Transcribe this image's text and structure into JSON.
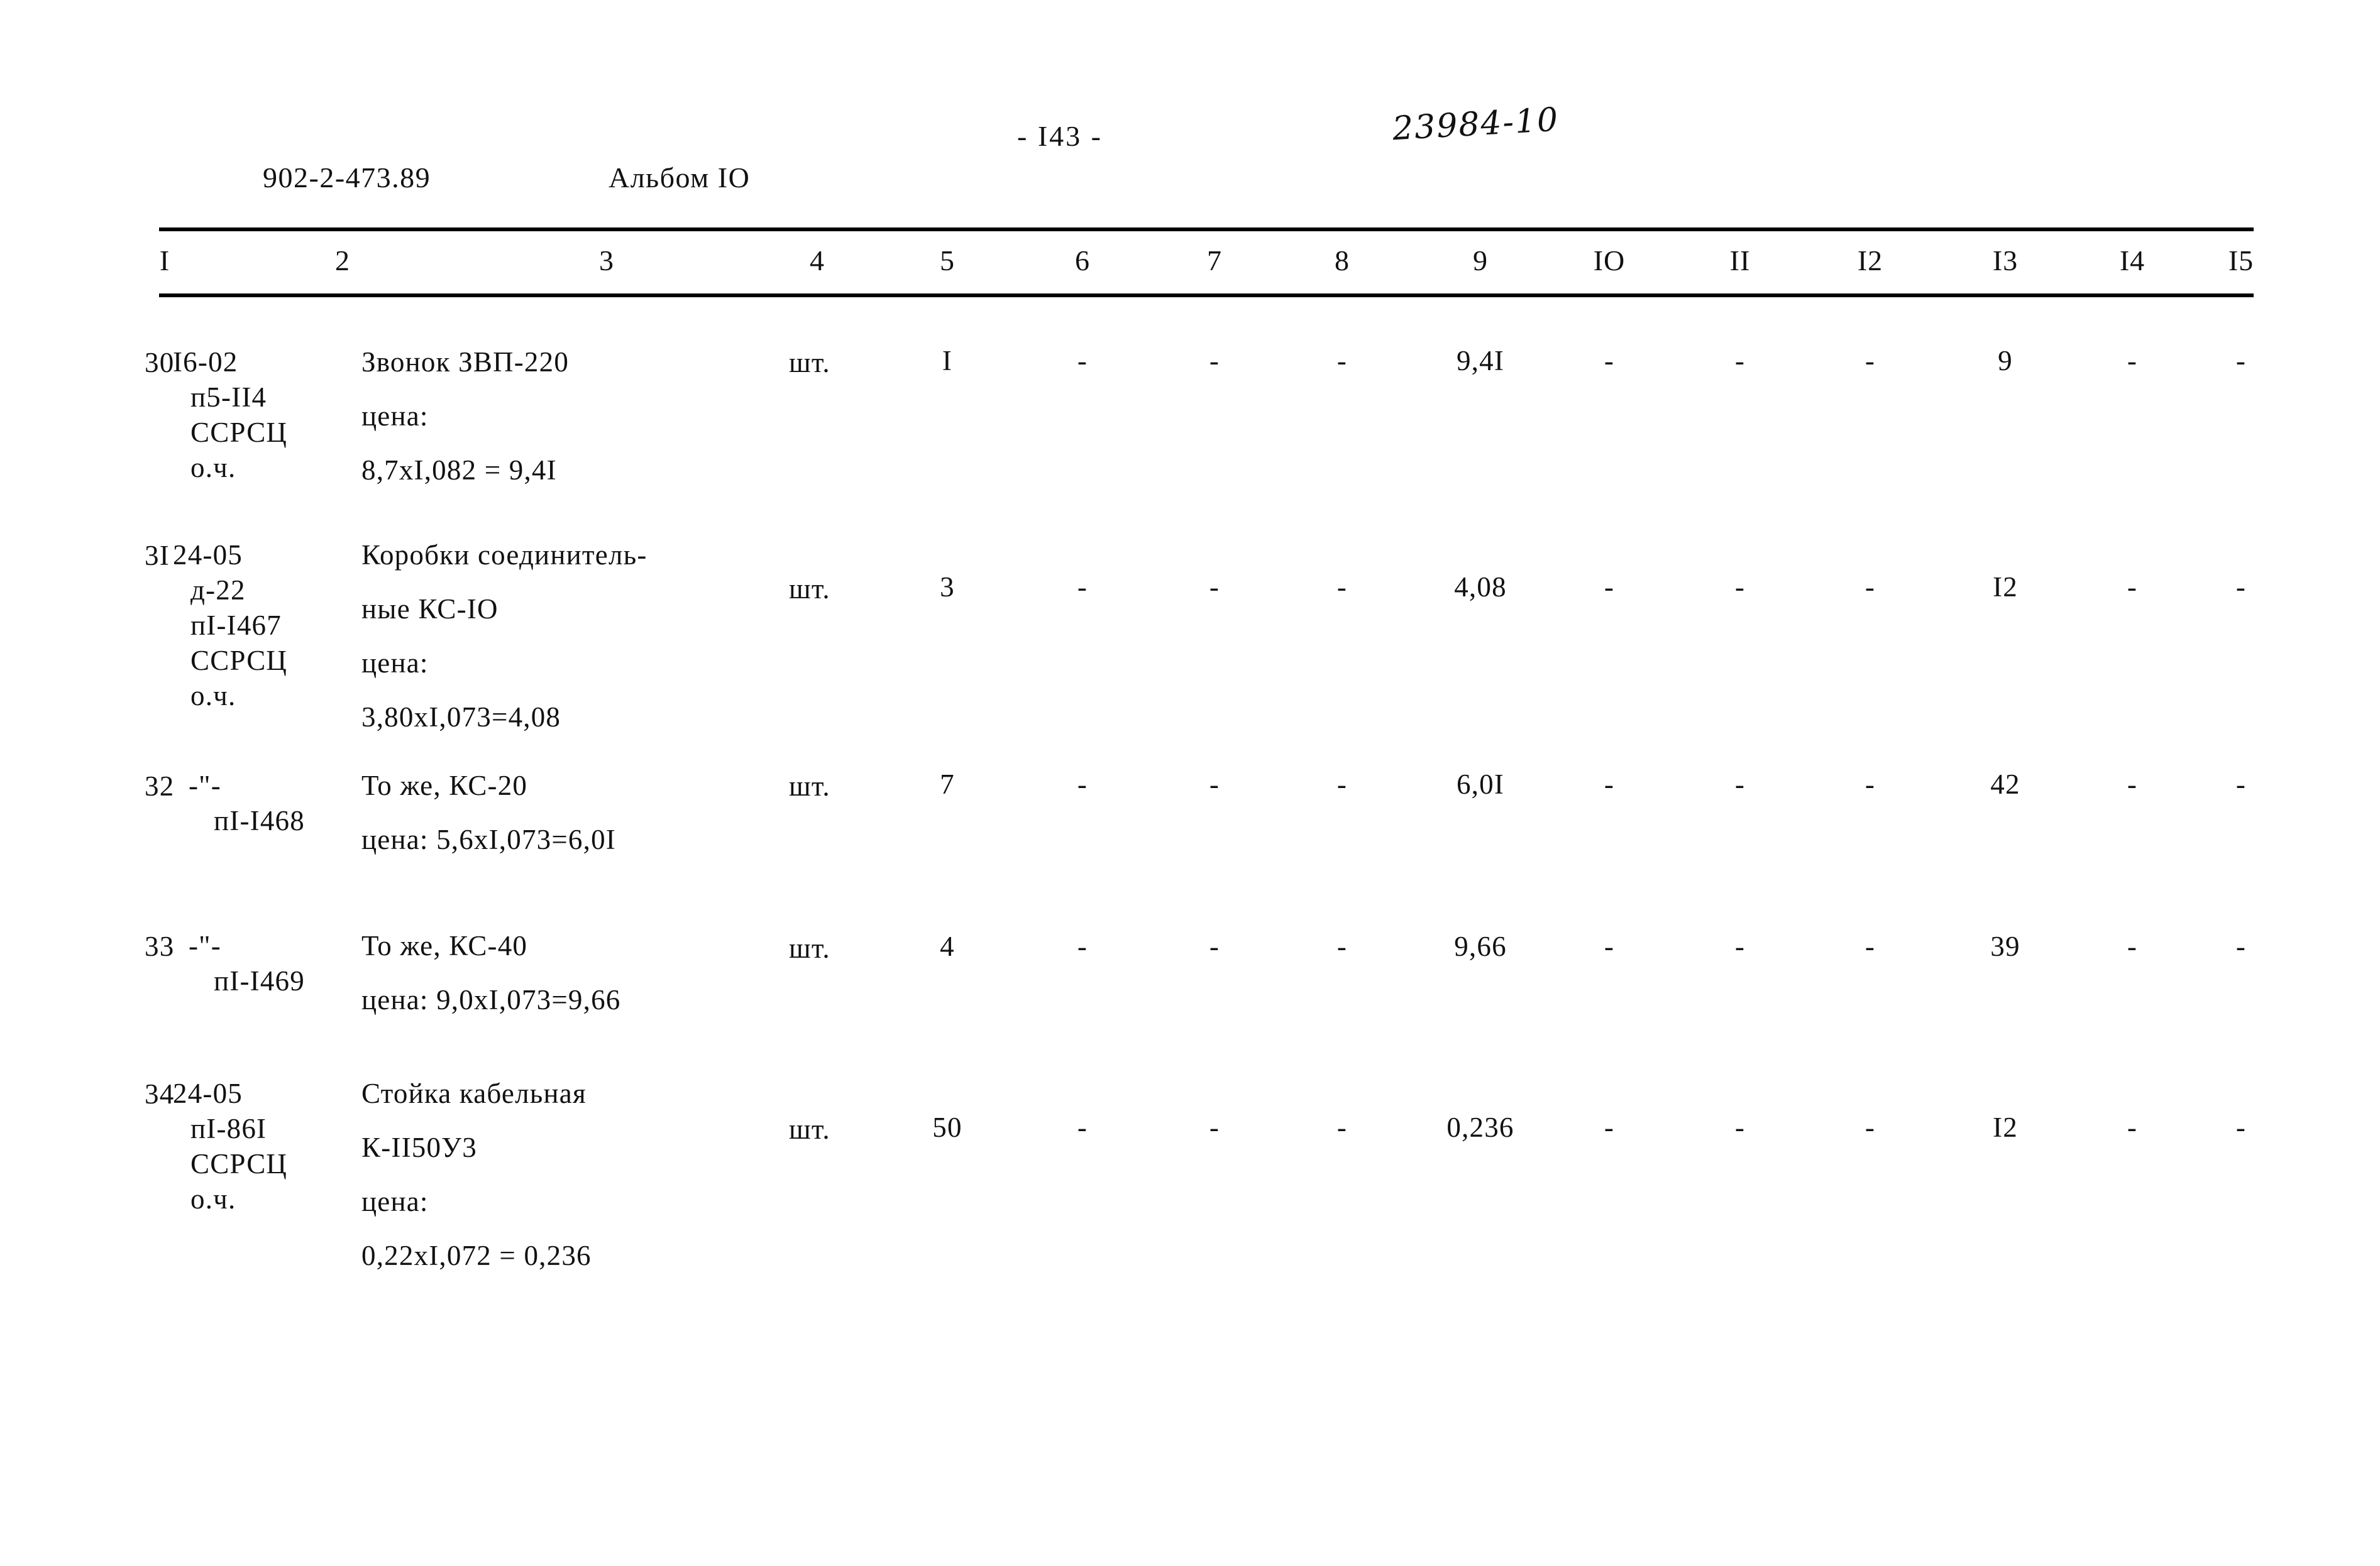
{
  "header": {
    "document_code": "902-2-473.89",
    "album": "Альбом IO",
    "page_number": "- I43 -",
    "stamp": "23984-10"
  },
  "table": {
    "column_headers": [
      "I",
      "2",
      "3",
      "4",
      "5",
      "6",
      "7",
      "8",
      "9",
      "IO",
      "II",
      "I2",
      "I3",
      "I4",
      "I5"
    ],
    "rows": [
      {
        "num": "30",
        "code_lines": [
          "I6-02",
          "п5-II4",
          "ССРСЦ",
          "о.ч."
        ],
        "name_lines": [
          "Звонок ЗВП-220",
          "цена:",
          "8,7хI,082 = 9,4I"
        ],
        "unit": "шт.",
        "qty": "I",
        "c6": "-",
        "c7": "-",
        "c8": "-",
        "c9": "9,4I",
        "c10": "-",
        "c11": "-",
        "c12": "-",
        "c13": "9",
        "c14": "-",
        "c15": "-"
      },
      {
        "num": "3I",
        "code_lines": [
          "24-05",
          "д-22",
          "пI-I467",
          "ССРСЦ",
          "о.ч."
        ],
        "name_lines": [
          "Коробки соединитель-",
          "ные КС-IO",
          "цена:",
          "3,80хI,073=4,08"
        ],
        "unit": "шт.",
        "qty": "3",
        "c6": "-",
        "c7": "-",
        "c8": "-",
        "c9": "4,08",
        "c10": "-",
        "c11": "-",
        "c12": "-",
        "c13": "I2",
        "c14": "-",
        "c15": "-"
      },
      {
        "num": "32",
        "code_lines": [
          "-\"-",
          "пI-I468"
        ],
        "name_lines": [
          "То же, КС-20",
          "цена: 5,6хI,073=6,0I"
        ],
        "unit": "шт.",
        "qty": "7",
        "c6": "-",
        "c7": "-",
        "c8": "-",
        "c9": "6,0I",
        "c10": "-",
        "c11": "-",
        "c12": "-",
        "c13": "42",
        "c14": "-",
        "c15": "-"
      },
      {
        "num": "33",
        "code_lines": [
          "-\"-",
          "пI-I469"
        ],
        "name_lines": [
          "То же, КС-40",
          "цена: 9,0хI,073=9,66"
        ],
        "unit": "шт.",
        "qty": "4",
        "c6": "-",
        "c7": "-",
        "c8": "-",
        "c9": "9,66",
        "c10": "-",
        "c11": "-",
        "c12": "-",
        "c13": "39",
        "c14": "-",
        "c15": "-"
      },
      {
        "num": "34",
        "code_lines": [
          "24-05",
          "пI-86I",
          "ССРСЦ",
          "о.ч."
        ],
        "name_lines": [
          "Стойка кабельная",
          "К-II50У3",
          "цена:",
          "0,22хI,072 = 0,236"
        ],
        "unit": "шт.",
        "qty": "50",
        "c6": "-",
        "c7": "-",
        "c8": "-",
        "c9": "0,236",
        "c10": "-",
        "c11": "-",
        "c12": "-",
        "c13": "I2",
        "c14": "-",
        "c15": "-"
      }
    ]
  }
}
